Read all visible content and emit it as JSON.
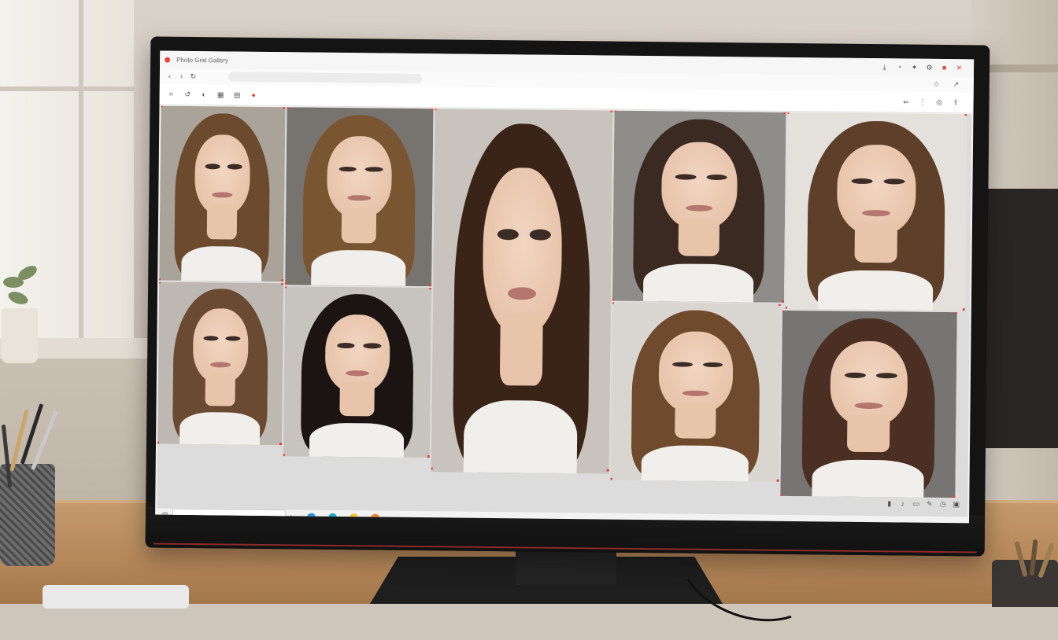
{
  "browser": {
    "title_text": "Photo Grid Gallery",
    "address_placeholder": "",
    "toolbar_menu": [
      "",
      "",
      "",
      "",
      "",
      "",
      ""
    ],
    "titlebar_icons": [
      "download-icon",
      "history-icon",
      "settings-icon",
      "close-icon"
    ],
    "toolbar_tools": [
      "crop-icon",
      "rotate-icon",
      "filter-icon",
      "grid-icon",
      "layers-icon"
    ]
  },
  "search": {
    "placeholder": ""
  },
  "dock_apps": [
    {
      "name": "app-blue",
      "color": "#2a8fe0"
    },
    {
      "name": "app-cyan",
      "color": "#1aa6c9"
    },
    {
      "name": "app-yellow",
      "color": "#f2c230"
    },
    {
      "name": "app-orange",
      "color": "#f08a2b"
    }
  ],
  "tray_icons": [
    "network-icon",
    "volume-icon",
    "battery-icon",
    "edit-icon",
    "clock-icon",
    "notification-icon"
  ],
  "colors": {
    "accent_red": "#e04a3a",
    "hair_brown": "#5a3b24",
    "hair_dark": "#1f1714",
    "skin": "#e8c4ab"
  },
  "photos": [
    {
      "id": "portrait-1",
      "hair": "#6b4a2e"
    },
    {
      "id": "portrait-2",
      "hair": "#7a5532"
    },
    {
      "id": "portrait-3-featured",
      "hair": "#3a2418"
    },
    {
      "id": "portrait-4",
      "hair": "#3b2a22"
    },
    {
      "id": "portrait-5",
      "hair": "#5e3f2a"
    },
    {
      "id": "portrait-6",
      "hair": "#6a4a31"
    },
    {
      "id": "portrait-7",
      "hair": "#1c1412"
    },
    {
      "id": "portrait-8",
      "hair": "#6f4a2c"
    },
    {
      "id": "portrait-9",
      "hair": "#4a2f22"
    }
  ]
}
